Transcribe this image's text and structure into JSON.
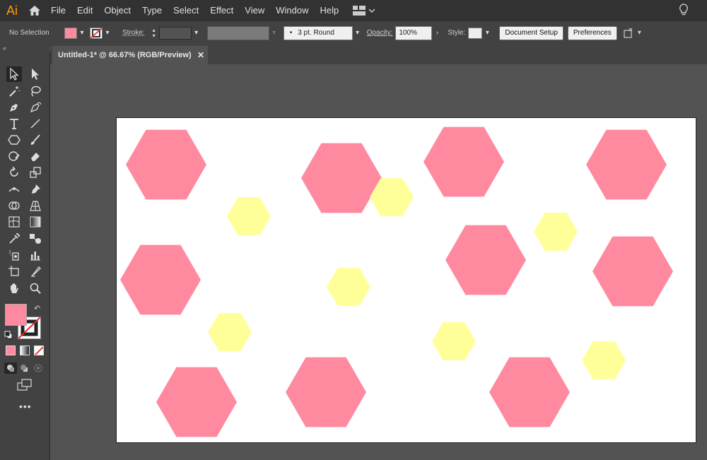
{
  "app": {
    "logo": "Ai"
  },
  "menu": [
    "File",
    "Edit",
    "Object",
    "Type",
    "Select",
    "Effect",
    "View",
    "Window",
    "Help"
  ],
  "control": {
    "selection": "No Selection",
    "stroke_label": "Stroke:",
    "brush": "3 pt. Round",
    "opacity_label": "Opacity:",
    "opacity_value": "100%",
    "style_label": "Style:",
    "doc_setup": "Document Setup",
    "preferences": "Preferences"
  },
  "document": {
    "tab_title": "Untitled-1* @ 66.67% (RGB/Preview)"
  },
  "colors": {
    "fill": "#ff8aa0",
    "pink_shape": "#ff8aa0",
    "yellow_shape": "#ffff99",
    "artboard": "#ffffff"
  },
  "shapes": [
    {
      "kind": "pink"
    },
    {
      "kind": "pink"
    },
    {
      "kind": "pink"
    },
    {
      "kind": "pink"
    },
    {
      "kind": "pink"
    },
    {
      "kind": "pink"
    },
    {
      "kind": "pink"
    },
    {
      "kind": "pink"
    },
    {
      "kind": "pink"
    },
    {
      "kind": "pink"
    },
    {
      "kind": "yellow"
    },
    {
      "kind": "yellow"
    },
    {
      "kind": "yellow"
    },
    {
      "kind": "yellow"
    },
    {
      "kind": "yellow"
    },
    {
      "kind": "yellow"
    },
    {
      "kind": "yellow"
    }
  ]
}
